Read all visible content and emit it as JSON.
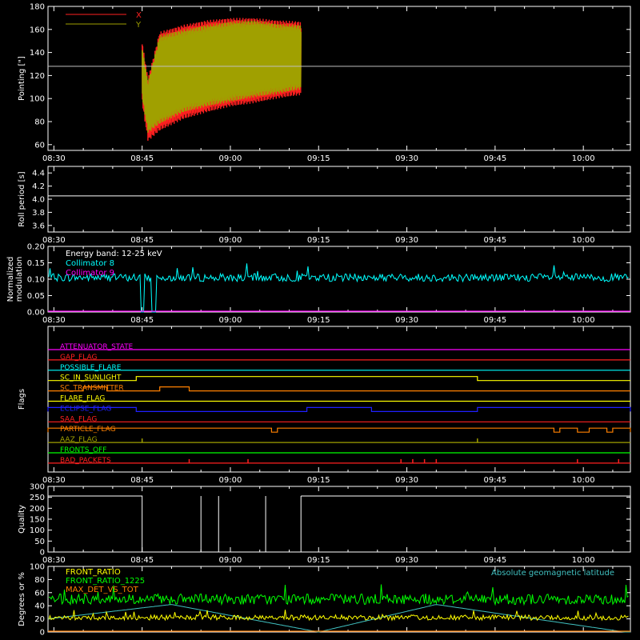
{
  "chart_data": [
    {
      "type": "line",
      "ylabel": "Pointing [\"]",
      "ylim": [
        55,
        180
      ],
      "yticks": [
        "60",
        "80",
        "100",
        "120",
        "140",
        "160",
        "180"
      ],
      "xticks": [
        "08:30",
        "08:45",
        "09:00",
        "09:15",
        "09:30",
        "09:45",
        "10:00"
      ],
      "x_range": [
        "08:29",
        "10:08"
      ],
      "reference_line": 128,
      "series": [
        {
          "name": "X",
          "color": "#ff2020",
          "x_range": [
            "08:45",
            "09:12"
          ],
          "envelope": {
            "x": [
              "08:45",
              "08:46",
              "08:48",
              "08:52",
              "08:56",
              "09:00",
              "09:04",
              "09:08",
              "09:12"
            ],
            "high": [
              150,
              118,
              158,
              164,
              168,
              170,
              170,
              168,
              167
            ],
            "low": [
              95,
              63,
              72,
              82,
              88,
              93,
              96,
              100,
              103
            ]
          }
        },
        {
          "name": "Y",
          "color": "#a0a000",
          "x_range": [
            "08:45",
            "09:12"
          ],
          "envelope": {
            "x": [
              "08:45",
              "08:46",
              "08:48",
              "08:52",
              "08:56",
              "09:00",
              "09:04",
              "09:08",
              "09:12"
            ],
            "high": [
              145,
              115,
              155,
              160,
              164,
              167,
              168,
              165,
              164
            ],
            "low": [
              100,
              70,
              78,
              88,
              93,
              97,
              101,
              104,
              108
            ]
          }
        }
      ]
    },
    {
      "type": "line",
      "ylabel": "Roll period [s]",
      "ylim": [
        3.5,
        4.5
      ],
      "yticks": [
        "3.6",
        "3.8",
        "4.0",
        "4.2",
        "4.4"
      ],
      "xticks": [
        "08:30",
        "08:45",
        "09:00",
        "09:15",
        "09:30",
        "09:45",
        "10:00"
      ],
      "series": [
        {
          "name": "",
          "color": "#ffffff",
          "value": 4.05
        }
      ]
    },
    {
      "type": "line",
      "ylabel": "Normalized modulation",
      "ylim": [
        0.0,
        0.2
      ],
      "yticks": [
        "0.00",
        "0.05",
        "0.10",
        "0.15",
        "0.20"
      ],
      "xticks": [
        "08:30",
        "08:45",
        "09:00",
        "09:15",
        "09:30",
        "09:45",
        "10:00"
      ],
      "annotation": "Energy band: 12-25 keV",
      "series": [
        {
          "name": "Collimator 8",
          "color": "#00ffff",
          "mean": 0.105,
          "noise": 0.012,
          "dropouts": [
            "08:45",
            "08:47"
          ]
        },
        {
          "name": "Collimator 9",
          "color": "#ff00ff",
          "value": 0.0
        }
      ]
    },
    {
      "type": "flags",
      "ylabel": "Flags",
      "xticks": [
        "08:30",
        "08:45",
        "09:00",
        "09:15",
        "09:30",
        "09:45",
        "10:00"
      ],
      "flags": [
        {
          "name": "ATTENUATOR_STATE",
          "color": "#ff00ff",
          "high": []
        },
        {
          "name": "GAP_FLAG",
          "color": "#ff2020",
          "high": []
        },
        {
          "name": "POSSIBLE_FLARE",
          "color": "#00ffff",
          "high": []
        },
        {
          "name": "SC_IN_SUNLIGHT",
          "color": "#ffff00",
          "high": [
            [
              "08:44",
              "09:42"
            ]
          ]
        },
        {
          "name": "SC_TRANSMITTER",
          "color": "#ff8000",
          "high": [
            [
              "08:35",
              "08:39"
            ],
            [
              "08:48",
              "08:53"
            ]
          ]
        },
        {
          "name": "FLARE_FLAG",
          "color": "#ffff00",
          "high": []
        },
        {
          "name": "ECLIPSE_FLAG",
          "color": "#2020ff",
          "high": [
            [
              "08:29",
              "08:44"
            ],
            [
              "09:13",
              "09:24"
            ],
            [
              "09:42",
              "10:08"
            ]
          ]
        },
        {
          "name": "SAA_FLAG",
          "color": "#ff2020",
          "high": []
        },
        {
          "name": "PARTICLE_FLAG",
          "color": "#ff8000",
          "high": [
            [
              "08:29",
              "09:07"
            ],
            [
              "09:08",
              "09:55"
            ],
            [
              "09:56",
              "09:59"
            ],
            [
              "10:01",
              "10:04"
            ],
            [
              "10:05",
              "10:08"
            ]
          ]
        },
        {
          "name": "AAZ_FLAG",
          "color": "#a0a000",
          "high": [],
          "spikes": [
            "08:45",
            "09:42"
          ]
        },
        {
          "name": "FRONTS_OFF",
          "color": "#00ff00",
          "high": []
        },
        {
          "name": "BAD_PACKETS",
          "color": "#ff2020",
          "high": [],
          "spikes": [
            "08:53",
            "09:03",
            "09:29",
            "09:31",
            "09:33",
            "09:35",
            "09:59",
            "10:06"
          ]
        }
      ]
    },
    {
      "type": "line",
      "ylabel": "Quality",
      "ylim": [
        0,
        300
      ],
      "yticks": [
        "0",
        "50",
        "100",
        "150",
        "200",
        "250",
        "300"
      ],
      "xticks": [
        "08:30",
        "08:45",
        "09:00",
        "09:15",
        "09:30",
        "09:45",
        "10:00"
      ],
      "series": [
        {
          "name": "",
          "color": "#ffffff",
          "segments": [
            {
              "x": [
                "08:29",
                "08:45"
              ],
              "value": 256
            },
            {
              "x": [
                "09:12",
                "10:08"
              ],
              "value": 256
            }
          ],
          "spikes": [
            "08:55",
            "08:58",
            "09:06"
          ]
        }
      ]
    },
    {
      "type": "line",
      "ylabel": "Degrees or %",
      "ylim": [
        0,
        100
      ],
      "yticks": [
        "0",
        "20",
        "40",
        "60",
        "80",
        "100"
      ],
      "xticks": [],
      "series": [
        {
          "name": "FRONT_RATIO",
          "color": "#ffff00",
          "mean": 22,
          "noise": 4
        },
        {
          "name": "FRONT_RATIO_1225",
          "color": "#00ff00",
          "mean": 50,
          "noise": 8
        },
        {
          "name": "MAX_DET_VS_TOT",
          "color": "#ff8000",
          "mean": 0,
          "noise": 0
        },
        {
          "name": "Absolute geomagnetic latitude",
          "color": "#40c0c0",
          "points": {
            "x": [
              "08:29",
              "08:50",
              "09:15",
              "09:35",
              "10:07"
            ],
            "y": [
              20,
              42,
              0,
              42,
              0
            ]
          }
        }
      ]
    }
  ]
}
